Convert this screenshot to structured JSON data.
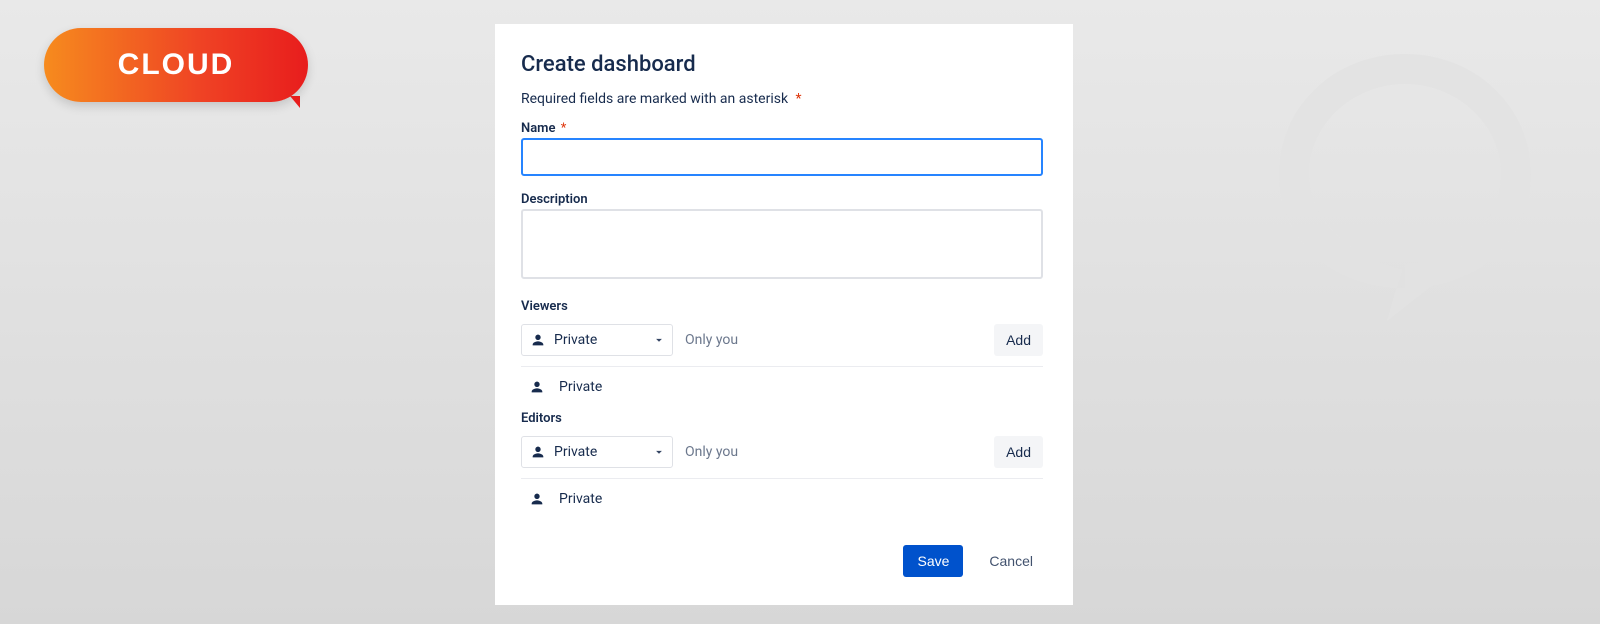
{
  "badge": {
    "text": "CLOUD"
  },
  "dialog": {
    "title": "Create dashboard",
    "required_note": "Required fields are marked with an asterisk",
    "asterisk": "*",
    "fields": {
      "name": {
        "label": "Name",
        "value": ""
      },
      "description": {
        "label": "Description",
        "value": ""
      }
    },
    "viewers": {
      "label": "Viewers",
      "select_value": "Private",
      "hint": "Only you",
      "add_label": "Add",
      "listed": "Private"
    },
    "editors": {
      "label": "Editors",
      "select_value": "Private",
      "hint": "Only you",
      "add_label": "Add",
      "listed": "Private"
    },
    "footer": {
      "save": "Save",
      "cancel": "Cancel"
    }
  },
  "colors": {
    "primary": "#0052CC",
    "focus": "#2684FF",
    "text": "#172B4D",
    "required": "#DE350B"
  }
}
